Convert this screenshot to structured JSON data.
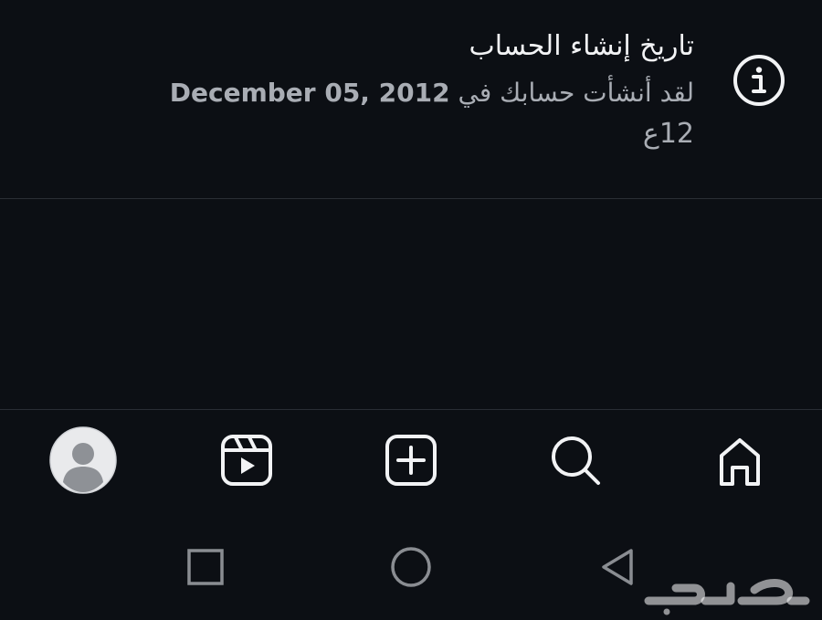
{
  "info": {
    "icon": "info-icon",
    "title": "تاريخ إنشاء الحساب",
    "desc_prefix": "لقد أنشأت حسابك في",
    "date": "December 05, 2012",
    "time": "12ع"
  },
  "bottom_nav": {
    "items": [
      {
        "icon": "profile-avatar"
      },
      {
        "icon": "reels-icon"
      },
      {
        "icon": "create-post-icon"
      },
      {
        "icon": "search-icon"
      },
      {
        "icon": "home-icon"
      }
    ]
  },
  "system_nav": {
    "items": [
      {
        "icon": "recents-square-icon"
      },
      {
        "icon": "home-circle-icon"
      },
      {
        "icon": "back-triangle-icon"
      }
    ]
  },
  "watermark": {
    "text": "حراج"
  },
  "colors": {
    "background": "#0c0f14",
    "primary_text": "#f2f3f5",
    "secondary_text": "#a9adb4",
    "divider": "#2a2e35",
    "system_nav": "#8a8d92"
  }
}
